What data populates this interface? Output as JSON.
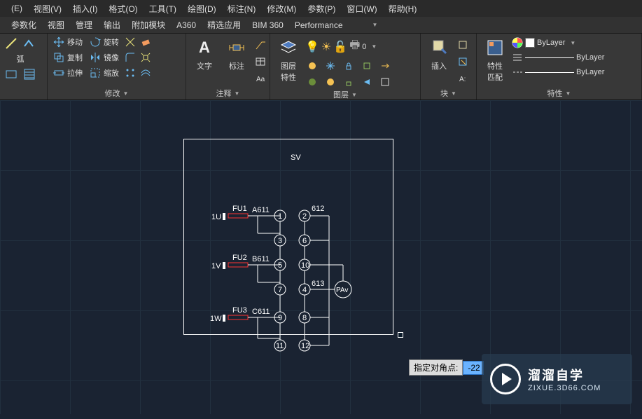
{
  "menubar": [
    "(E)",
    "视图(V)",
    "插入(I)",
    "格式(O)",
    "工具(T)",
    "绘图(D)",
    "标注(N)",
    "修改(M)",
    "参数(P)",
    "窗口(W)",
    "帮助(H)"
  ],
  "tabs": [
    "参数化",
    "视图",
    "管理",
    "输出",
    "附加模块",
    "A360",
    "精选应用",
    "BIM 360",
    "Performance"
  ],
  "ribbon": {
    "modify": {
      "title": "修改",
      "move": "移动",
      "rotate": "旋转",
      "copy": "复制",
      "mirror": "镜像",
      "stretch": "拉伸",
      "scale": "缩放",
      "arc_label": "弧"
    },
    "annot": {
      "title": "注释",
      "text": "文字",
      "dim": "标注"
    },
    "layer": {
      "title": "图层",
      "props": "图层\n特性"
    },
    "block": {
      "title": "块",
      "insert": "插入"
    },
    "props": {
      "title": "特性",
      "props": "特性",
      "match": "匹配",
      "bylayer": "ByLayer",
      "bylayer2": "ByLayer",
      "bylayer3": "ByLayer"
    }
  },
  "schematic": {
    "title": "SV",
    "rows": [
      {
        "term": "1U",
        "fuse": "FU1",
        "wire": "A611",
        "left_nodes": [
          "1",
          "3",
          "5",
          "7",
          "11"
        ],
        "right_top": "612"
      },
      {
        "term": "1V",
        "fuse": "FU2",
        "wire": "B611",
        "right_nodes": [
          "2",
          "6",
          "10",
          "4",
          "8",
          "12"
        ],
        "pa": "PAv",
        "mid": "613"
      },
      {
        "term": "1W",
        "fuse": "FU3",
        "wire": "C611"
      }
    ]
  },
  "prompt": {
    "label": "指定对角点:",
    "value": "-22"
  },
  "watermark": {
    "t1": "溜溜自学",
    "t2": "ZIXUE.3D66.COM"
  }
}
